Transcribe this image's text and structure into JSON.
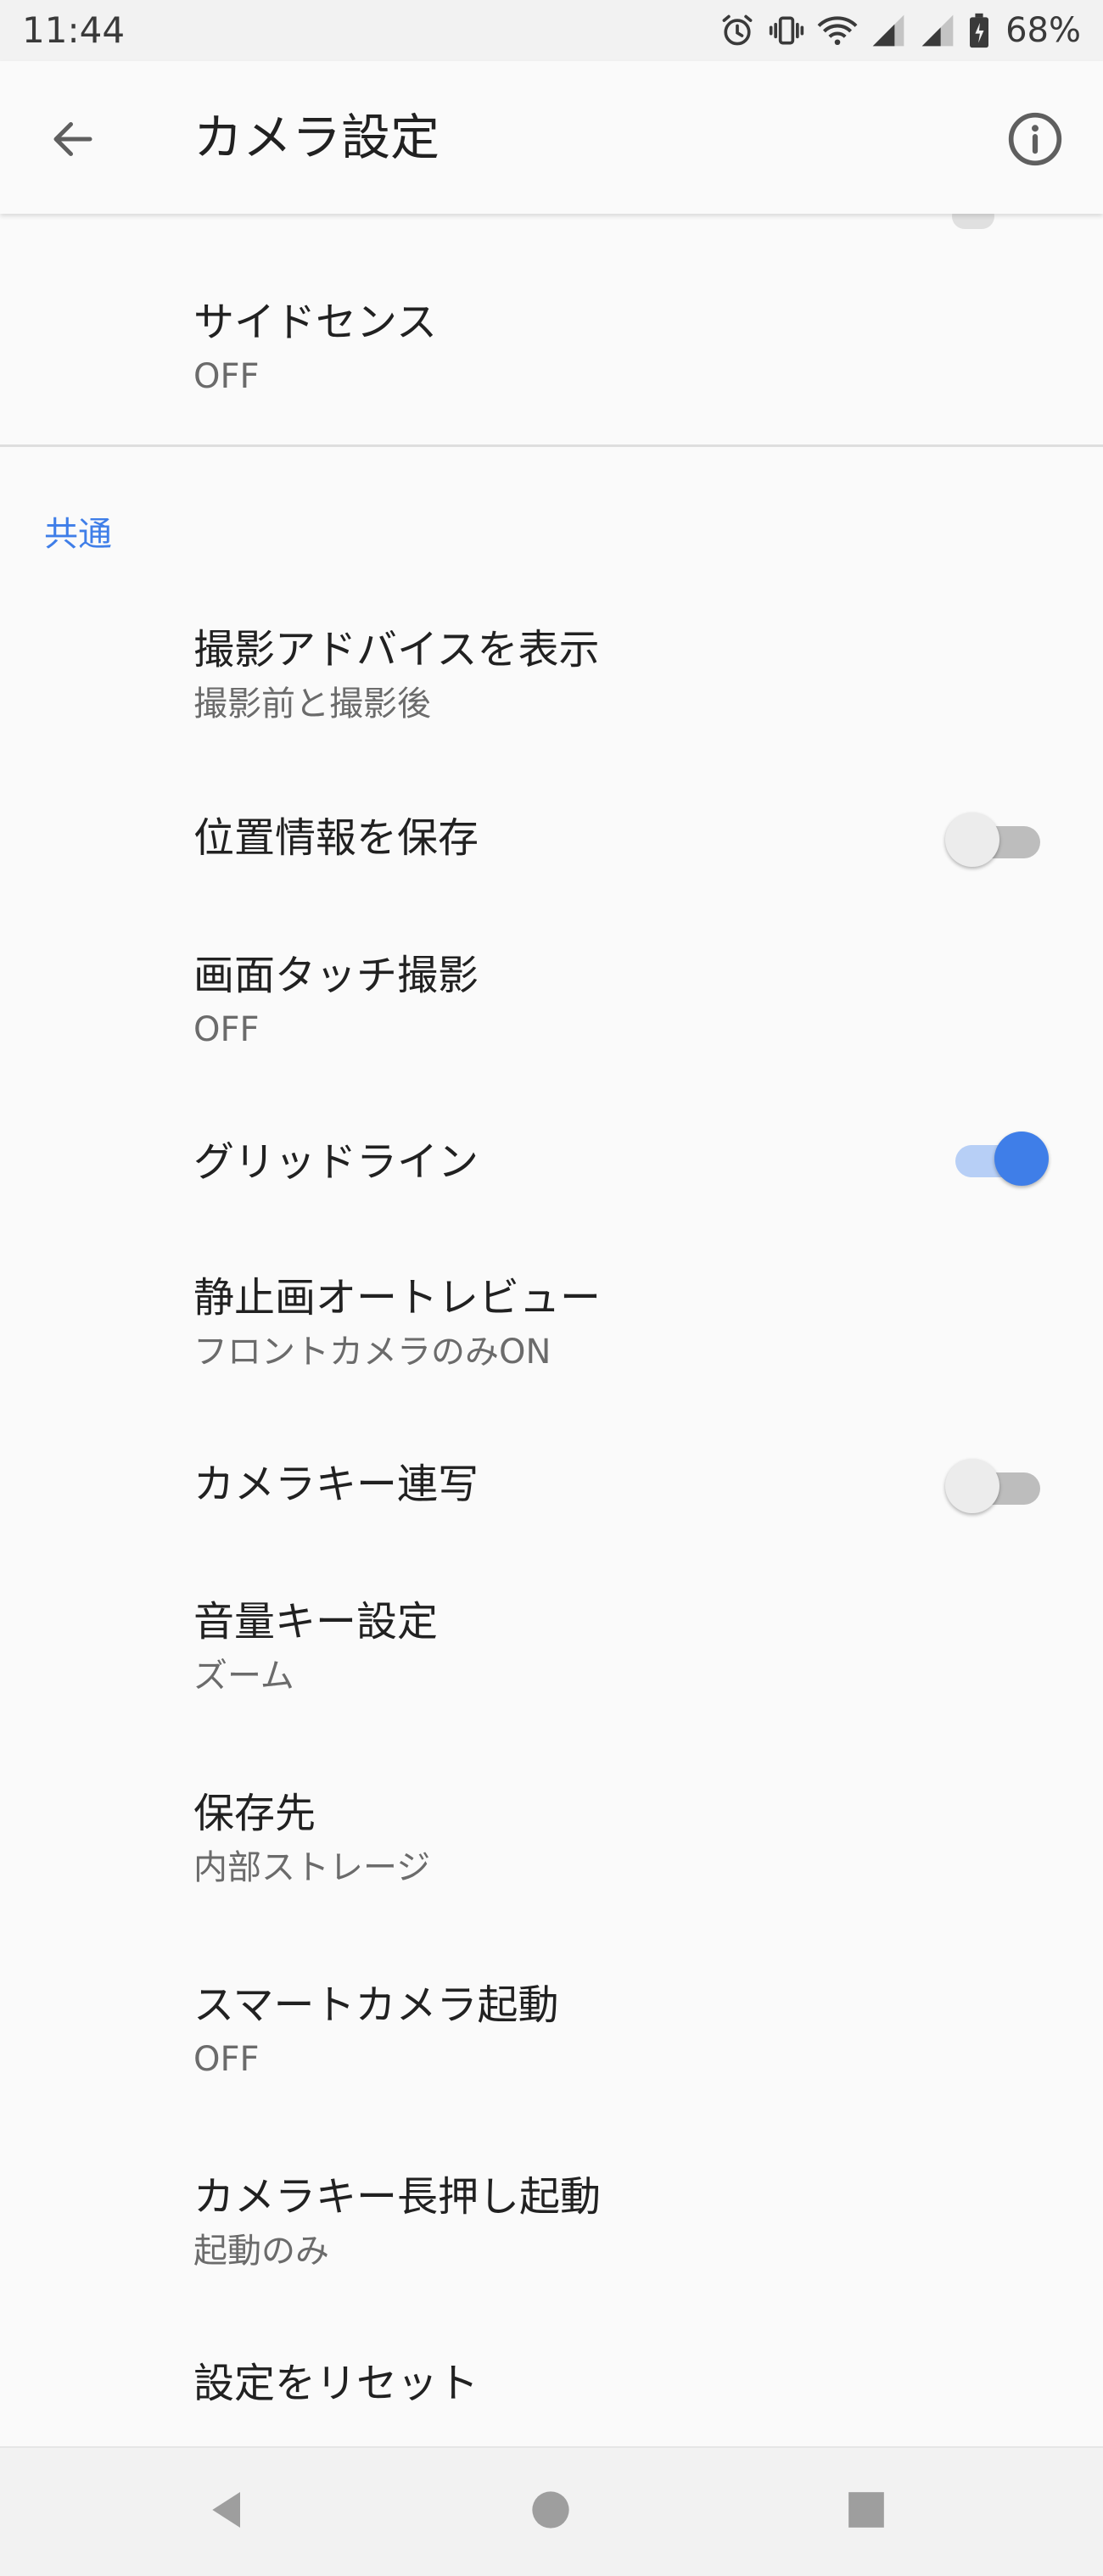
{
  "status_bar": {
    "time": "11:44",
    "battery": "68%",
    "icons": [
      "alarm-icon",
      "vibrate-icon",
      "wifi-icon",
      "signal-icon",
      "signal-icon",
      "battery-icon"
    ]
  },
  "app_bar": {
    "title": "カメラ設定",
    "back_icon": "arrow-left-icon",
    "info_icon": "info-icon"
  },
  "top_item": {
    "title": "サイドセンス",
    "summary": "OFF"
  },
  "section": {
    "header": "共通",
    "items": [
      {
        "title": "撮影アドバイスを表示",
        "summary": "撮影前と撮影後"
      },
      {
        "title": "位置情報を保存",
        "toggle": false
      },
      {
        "title": "画面タッチ撮影",
        "summary": "OFF"
      },
      {
        "title": "グリッドライン",
        "toggle": true
      },
      {
        "title": "静止画オートレビュー",
        "summary": "フロントカメラのみON"
      },
      {
        "title": "カメラキー連写",
        "toggle": false
      },
      {
        "title": "音量キー設定",
        "summary": "ズーム"
      },
      {
        "title": "保存先",
        "summary": "内部ストレージ"
      },
      {
        "title": "スマートカメラ起動",
        "summary": "OFF"
      },
      {
        "title": "カメラキー長押し起動",
        "summary": "起動のみ"
      },
      {
        "title": "設定をリセット"
      }
    ]
  },
  "nav_bar": {
    "icons": [
      "nav-back-icon",
      "nav-home-icon",
      "nav-recents-icon"
    ]
  },
  "colors": {
    "accent": "#3f7ee8",
    "accent_track": "#b7cff6",
    "background": "#fafafa"
  }
}
